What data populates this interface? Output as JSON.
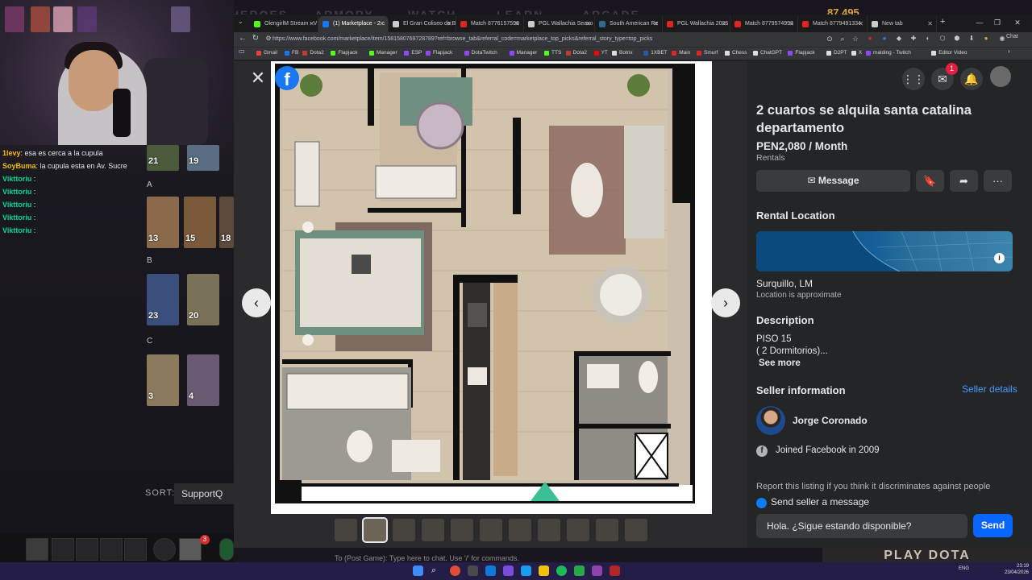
{
  "stream": {
    "chat": [
      {
        "user": "1levy",
        "text": ": esa es cerca a la cupula",
        "color": "#ffb800"
      },
      {
        "user": "SoyBuma",
        "text": ": la cupula esta en Av. Sucre",
        "color": "#e8c100"
      },
      {
        "user": "Vikttoriu",
        "text": " :",
        "color": "#00d68f"
      },
      {
        "user": "Vikttoriu",
        "text": " :",
        "color": "#00d68f"
      },
      {
        "user": "Vikttoriu",
        "text": " :",
        "color": "#00d68f"
      },
      {
        "user": "Vikttoriu",
        "text": " :",
        "color": "#00d68f"
      },
      {
        "user": "Vikttoriu",
        "text": " :",
        "color": "#00d68f"
      }
    ],
    "tiers": [
      "A",
      "B",
      "C"
    ],
    "hero_numbers": [
      "21",
      "19",
      "13",
      "15",
      "18",
      "23",
      "20",
      "3",
      "4"
    ],
    "sort_label": "SORT:",
    "sort_value": "SupportQ",
    "game_header_items": [
      "HEROES",
      "ARMORY",
      "WATCH",
      "LEARN",
      "ARCADE"
    ],
    "gold": "87,495",
    "chat_bar_text": "To (Post Game): Type here to chat. Use '/' for commands.",
    "play_dota": "PLAY DOTA",
    "hud_badge": "3"
  },
  "browser": {
    "tabs": [
      {
        "label": "OlengirlM Stream - V",
        "color": "#53fc18"
      },
      {
        "label": "(1) Marketplace - 2 c",
        "color": "#1877f2",
        "active": true
      },
      {
        "label": "El Gran Coliseo de B",
        "color": "#cccccc"
      },
      {
        "label": "Match 8776157596",
        "color": "#e02424"
      },
      {
        "label": "PGL Wallachia Seaso",
        "color": "#cccccc"
      },
      {
        "label": "South American Re",
        "color": "#2c6b8f"
      },
      {
        "label": "PGL Wallachia 2026",
        "color": "#e02424"
      },
      {
        "label": "Match 8779574993",
        "color": "#e02424"
      },
      {
        "label": "Match 8779491334",
        "color": "#e02424"
      },
      {
        "label": "New tab",
        "color": "#cccccc"
      }
    ],
    "url": "https://www.facebook.com/marketplace/item/1581580769728789?ref=browse_tab&referral_code=marketplace_top_picks&referral_story_type=top_picks",
    "bookmarks": [
      {
        "label": "Gmail",
        "color": "#ea4335"
      },
      {
        "label": "FB",
        "color": "#1877f2"
      },
      {
        "label": "Dota2",
        "color": "#c23c2a"
      },
      {
        "label": "Flapjack",
        "color": "#53fc18"
      },
      {
        "label": "Manager",
        "color": "#53fc18"
      },
      {
        "label": "ESP",
        "color": "#9146ff"
      },
      {
        "label": "Flapjack",
        "color": "#9146ff"
      },
      {
        "label": "DotaTwitch",
        "color": "#9146ff"
      },
      {
        "label": "Manager",
        "color": "#9146ff"
      },
      {
        "label": "TTS",
        "color": "#53fc18"
      },
      {
        "label": "Dota2",
        "color": "#c23c2a"
      },
      {
        "label": "YT",
        "color": "#ff0000"
      },
      {
        "label": "Botrix",
        "color": "#dddddd"
      },
      {
        "label": "1XBET",
        "color": "#1b5faa"
      },
      {
        "label": "Main",
        "color": "#e02424"
      },
      {
        "label": "Smurf",
        "color": "#e02424"
      },
      {
        "label": "Chess",
        "color": "#dddddd"
      },
      {
        "label": "ChatGPT",
        "color": "#dddddd"
      },
      {
        "label": "Flapjack",
        "color": "#9146ff"
      },
      {
        "label": "D2PT",
        "color": "#dddddd"
      },
      {
        "label": "X",
        "color": "#dddddd"
      },
      {
        "label": "malding - Twitch",
        "color": "#9146ff"
      },
      {
        "label": "Editor Video",
        "color": "#dddddd"
      }
    ]
  },
  "viewer": {
    "close_icon": "close-icon",
    "prev_icon": "chevron-left-icon",
    "next_icon": "chevron-right-icon",
    "thumb_count": 11,
    "active_thumb": 1
  },
  "listing": {
    "title": "2 cuartos se alquila santa catalina departamento",
    "price": "PEN2,080 / Month",
    "category": "Rentals",
    "message_label": "Message",
    "notification_count": "1",
    "rental_location_heading": "Rental Location",
    "location": "Surquillo, LM",
    "location_note": "Location is approximate",
    "description_heading": "Description",
    "description_line1": "PISO 15",
    "description_line2": "( 2 Dormitorios)...",
    "see_more": "See more",
    "seller_heading": "Seller information",
    "seller_details": "Seller details",
    "seller_name": "Jorge Coronado",
    "joined": "Joined Facebook in 2009",
    "report_text": "Report this listing if you think it discriminates against people",
    "send_heading": "Send seller a message",
    "message_value": "Hola. ¿Sigue estando disponible?",
    "send_label": "Send"
  },
  "taskbar": {
    "time": "23:19",
    "date": "23/04/2026",
    "lang": "ENG"
  },
  "colors": {
    "fb_blue": "#1877f2",
    "send_blue": "#0866ff",
    "link_blue": "#4599ff",
    "panel_bg": "#242526"
  }
}
